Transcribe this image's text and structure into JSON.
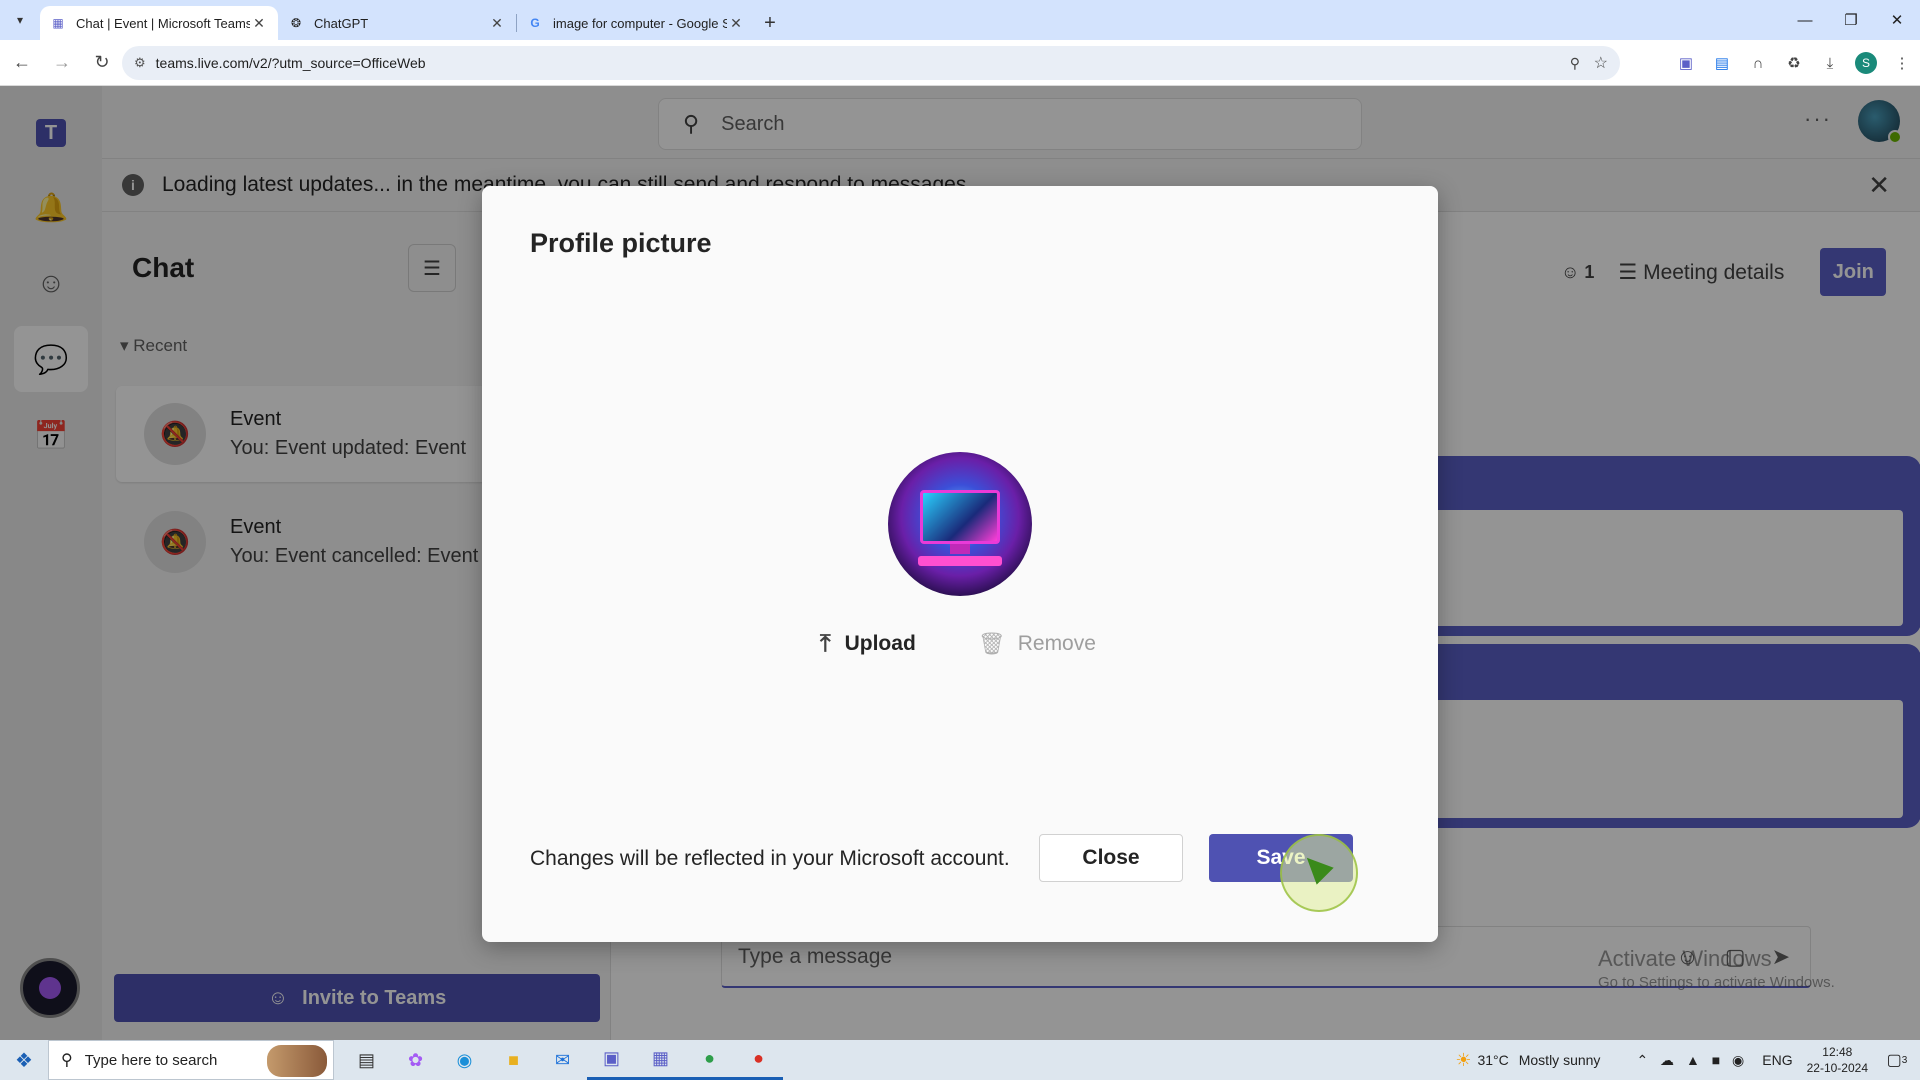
{
  "browser": {
    "tabs": [
      {
        "title": "Chat | Event | Microsoft Teams",
        "icon": "teams-icon",
        "active": true
      },
      {
        "title": "ChatGPT",
        "icon": "chatgpt-icon",
        "active": false
      },
      {
        "title": "image for computer - Google S",
        "icon": "google-icon",
        "active": false
      }
    ],
    "url": "teams.live.com/v2/?utm_source=OfficeWeb",
    "profile_initial": "S"
  },
  "teams": {
    "search_placeholder": "Search",
    "banner_text": "Loading latest updates... in the meantime, you can still send and respond to messages.",
    "chat_title": "Chat",
    "recent_label": "Recent",
    "chats": [
      {
        "name": "Event",
        "preview": "You: Event updated: Event"
      },
      {
        "name": "Event",
        "preview": "You: Event cancelled: Event"
      }
    ],
    "invite_label": "Invite to Teams",
    "participants_count": "1",
    "meeting_details_label": "Meeting details",
    "join_label": "Join",
    "compose_placeholder": "Type a message"
  },
  "dialog": {
    "title": "Profile picture",
    "upload_label": "Upload",
    "remove_label": "Remove",
    "note": "Changes will be reflected in your Microsoft account.",
    "close_label": "Close",
    "save_label": "Save"
  },
  "watermark": {
    "line1": "Activate Windows",
    "line2": "Go to Settings to activate Windows."
  },
  "taskbar": {
    "search_placeholder": "Type here to search",
    "temperature": "31°C",
    "weather": "Mostly sunny",
    "language": "ENG",
    "time": "12:48",
    "date": "22-10-2024",
    "notification_count": "3"
  },
  "colors": {
    "teams_purple": "#5b5fc7",
    "save_button": "#4f52b2",
    "tabbar": "#d3e3fd"
  }
}
